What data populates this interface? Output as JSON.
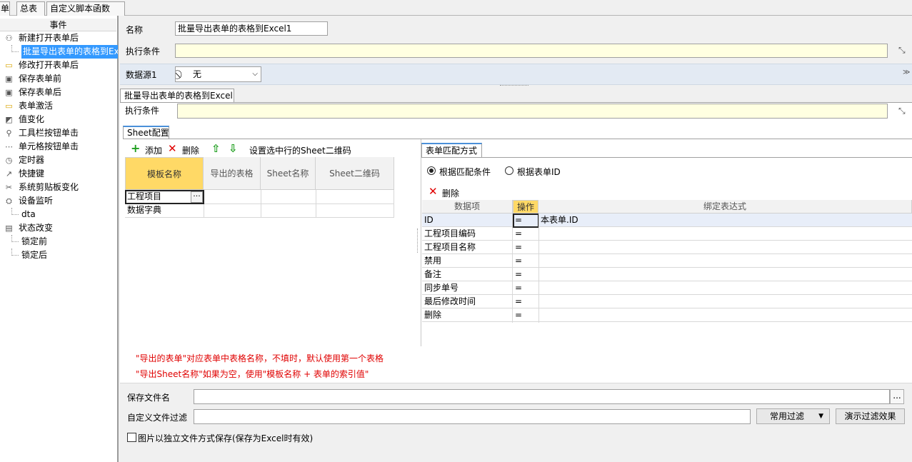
{
  "tabs": {
    "t0": "单",
    "t1": "总表",
    "t2": "自定义脚本函数"
  },
  "left": {
    "header": "事件",
    "items": [
      {
        "label": "新建打开表单后",
        "icon": "user-icon"
      },
      {
        "label": "批量导出表单的表格到Excel",
        "icon": "",
        "child": true,
        "selected": true
      },
      {
        "label": "修改打开表单后",
        "icon": "folder-icon"
      },
      {
        "label": "保存表单前",
        "icon": "save-icon"
      },
      {
        "label": "保存表单后",
        "icon": "save-icon"
      },
      {
        "label": "表单激活",
        "icon": "folder-icon"
      },
      {
        "label": "值变化",
        "icon": "value-icon"
      },
      {
        "label": "工具栏按钮单击",
        "icon": "search-icon"
      },
      {
        "label": "单元格按钮单击",
        "icon": "ellipsis-icon"
      },
      {
        "label": "定时器",
        "icon": "timer-icon"
      },
      {
        "label": "快捷键",
        "icon": "shortcut-icon"
      },
      {
        "label": "系统剪贴板变化",
        "icon": "scissors-icon"
      },
      {
        "label": "设备监听",
        "icon": "device-icon"
      },
      {
        "label": "dta",
        "icon": "",
        "child": true
      },
      {
        "label": "状态改变",
        "icon": "state-icon"
      },
      {
        "label": "锁定前",
        "icon": "",
        "child": true
      },
      {
        "label": "锁定后",
        "icon": "",
        "child": true
      }
    ]
  },
  "main": {
    "name_label": "名称",
    "name_value": "批量导出表单的表格到Excel1",
    "cond_label": "执行条件",
    "ds_label": "数据源1",
    "ds_value": "无",
    "sub_tab": "批量导出表单的表格到Excel",
    "sub_cond_label": "执行条件",
    "sheet_tab": "Sheet配置",
    "toolbar": {
      "add": "添加",
      "del": "删除",
      "qr": "设置选中行的Sheet二维码"
    },
    "sheet_headers": [
      "模板名称",
      "导出的表格",
      "Sheet名称",
      "Sheet二维码"
    ],
    "sheet_rows": [
      "工程项目",
      "数据字典"
    ],
    "match_tab": "表单匹配方式",
    "radio1": "根据匹配条件",
    "radio2": "根据表单ID",
    "match_del": "删除",
    "match_headers": [
      "数据项",
      "操作",
      "绑定表达式"
    ],
    "match_rows": [
      {
        "item": "ID",
        "op": "=",
        "expr": "本表单.ID"
      },
      {
        "item": "工程项目编码",
        "op": "=",
        "expr": ""
      },
      {
        "item": "工程项目名称",
        "op": "=",
        "expr": ""
      },
      {
        "item": "禁用",
        "op": "=",
        "expr": ""
      },
      {
        "item": "备注",
        "op": "=",
        "expr": ""
      },
      {
        "item": "同步单号",
        "op": "=",
        "expr": ""
      },
      {
        "item": "最后修改时间",
        "op": "=",
        "expr": ""
      },
      {
        "item": "删除",
        "op": "=",
        "expr": ""
      }
    ],
    "note1": "\"导出的表单\"对应表单中表格名称，不填时，默认使用第一个表格",
    "note2": "\"导出Sheet名称\"如果为空，使用\"模板名称 + 表单的索引值\"",
    "save_label": "保存文件名",
    "browse": "...",
    "filter_label": "自定义文件过滤",
    "common_filter": "常用过滤",
    "demo_filter": "演示过滤效果",
    "img_check": "图片以独立文件方式保存(保存为Excel时有效)"
  },
  "colors": {
    "selected": "#3399ff",
    "yellow": "#ffffe1",
    "hdr_yellow": "#ffd966",
    "red": "#e00000",
    "green": "#1e9e1e"
  }
}
